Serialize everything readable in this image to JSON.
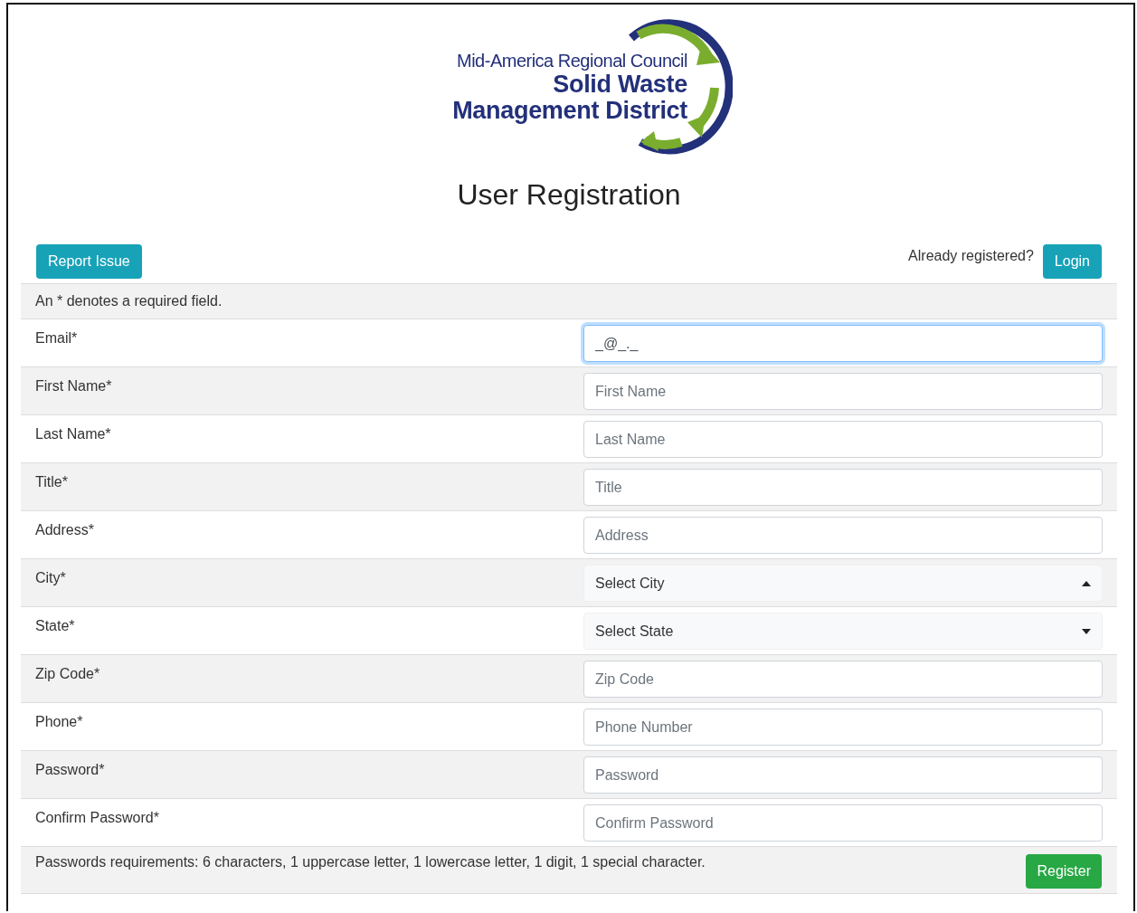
{
  "logo": {
    "line_1": "Mid-America Regional Council",
    "line_2": "Solid Waste",
    "line_3": "Management District"
  },
  "title": "User Registration",
  "toolbar": {
    "report_button": "Report Issue",
    "login_prompt": "Already registered?",
    "login_button": "Login"
  },
  "note": "An * denotes a required field.",
  "fields": [
    {
      "kind": "input",
      "label": "Email*",
      "value": "_@_._",
      "focused": true
    },
    {
      "kind": "input",
      "label": "First Name*",
      "placeholder": "First Name",
      "focused": false
    },
    {
      "kind": "input",
      "label": "Last Name*",
      "placeholder": "Last Name",
      "focused": false
    },
    {
      "kind": "input",
      "label": "Title*",
      "placeholder": "Title",
      "focused": false
    },
    {
      "kind": "input",
      "label": "Address*",
      "placeholder": "Address",
      "focused": false
    },
    {
      "kind": "select",
      "label": "City*",
      "value": "Select City",
      "expanded": true
    },
    {
      "kind": "select",
      "label": "State*",
      "value": "Select State",
      "expanded": false
    },
    {
      "kind": "input",
      "label": "Zip Code*",
      "placeholder": "Zip Code",
      "focused": false
    },
    {
      "kind": "input",
      "label": "Phone*",
      "placeholder": "Phone Number",
      "focused": false
    },
    {
      "kind": "input",
      "label": "Password*",
      "placeholder": "Password",
      "focused": false
    },
    {
      "kind": "input",
      "label": "Confirm Password*",
      "placeholder": "Confirm Password",
      "focused": false
    }
  ],
  "footer": {
    "requirements": "Passwords requirements: 6 characters, 1 uppercase letter, 1 lowercase letter, 1 digit, 1 special character.",
    "register_button": "Register"
  }
}
